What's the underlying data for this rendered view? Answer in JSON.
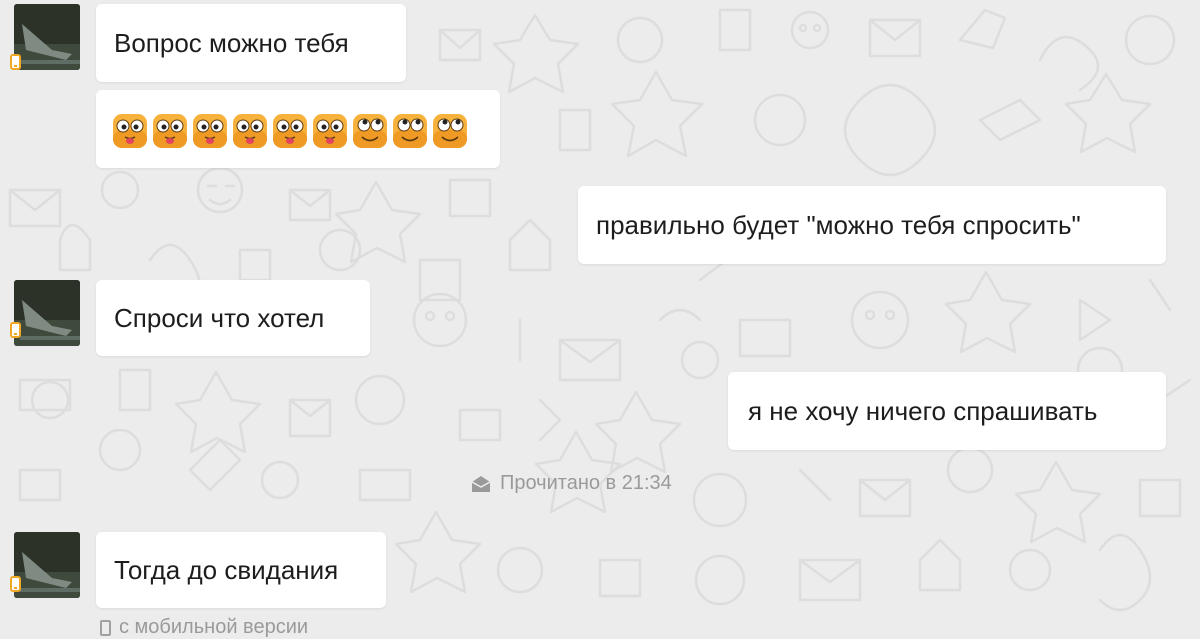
{
  "messages": [
    {
      "side": "incoming",
      "text": "Вопрос  можно тебя"
    },
    {
      "side": "incoming",
      "emoji_count": 9,
      "emoji_names": [
        "tongue-face-emoji",
        "tongue-face-emoji",
        "tongue-face-emoji",
        "tongue-face-emoji",
        "tongue-face-emoji",
        "tongue-face-emoji",
        "eyes-up-face-emoji",
        "eyes-up-face-emoji",
        "eyes-up-face-emoji"
      ]
    },
    {
      "side": "outgoing",
      "text": "правильно будет \"можно тебя спросить\""
    },
    {
      "side": "incoming",
      "text": "Спроси что хотел"
    },
    {
      "side": "outgoing",
      "text": "я не хочу ничего спрашивать"
    },
    {
      "side": "incoming",
      "text": "Тогда до свидания"
    }
  ],
  "read_receipt": {
    "text": "Прочитано в 21:34",
    "icon": "envelope-open-icon"
  },
  "footer_note": {
    "text": "с мобильной версии",
    "icon": "mobile-phone-icon"
  },
  "colors": {
    "background": "#ececec",
    "bubble": "#ffffff",
    "text": "#1d1d1d",
    "muted": "#9a9a9a",
    "mobile_badge": "#f0a824",
    "emoji_yellow": "#f7b13d"
  }
}
